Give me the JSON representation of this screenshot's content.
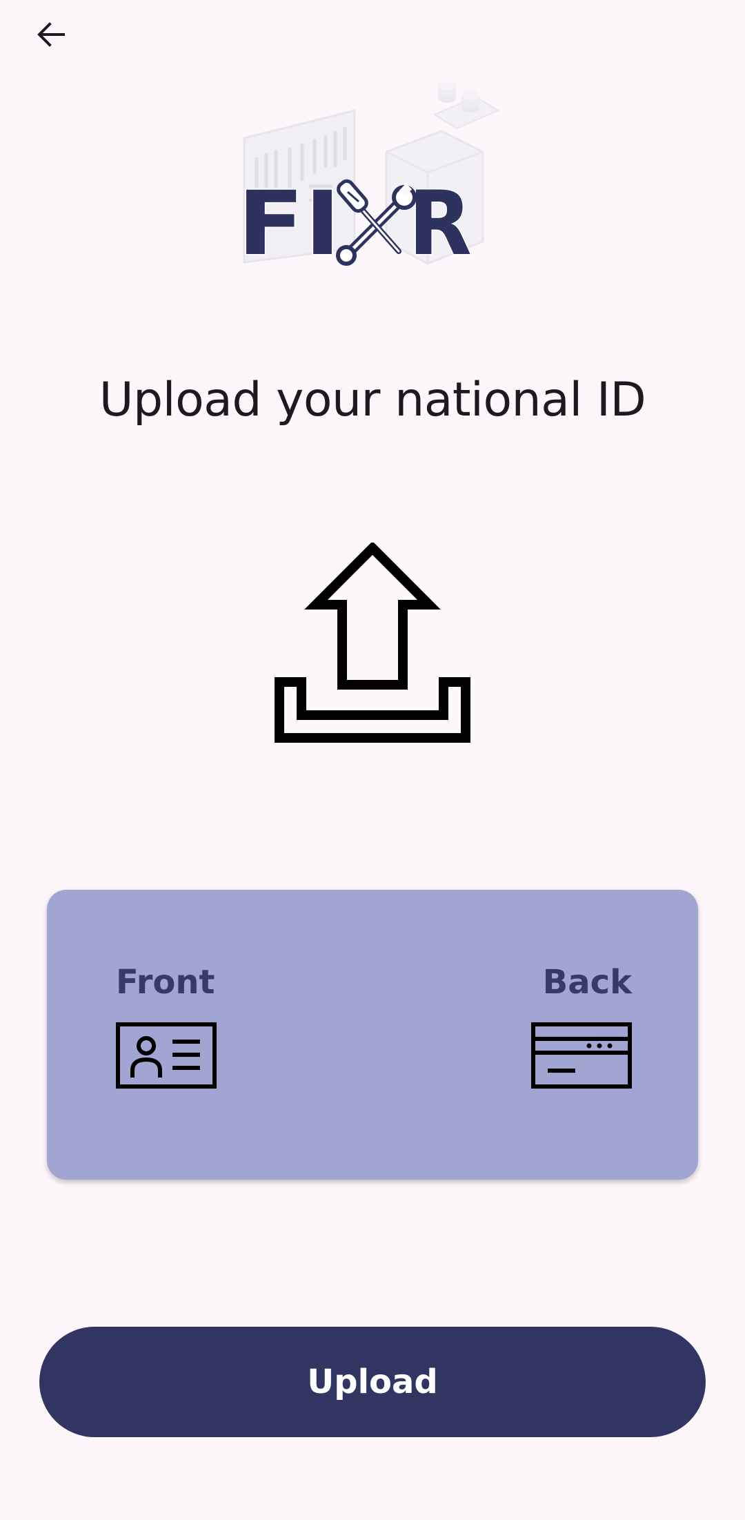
{
  "header": {
    "back_icon": "arrow-left-icon"
  },
  "logo": {
    "text": "FIXR",
    "left_letters": "FI",
    "right_letter": "R",
    "tools_icon": "screwdriver-wrench-icon",
    "color": "#2e325f"
  },
  "main": {
    "title": "Upload your national ID",
    "upload_icon": "upload-tray-icon"
  },
  "id_card": {
    "background": "#a0a5d1",
    "front": {
      "label": "Front",
      "icon": "id-card-front-icon"
    },
    "back": {
      "label": "Back",
      "icon": "id-card-back-icon"
    }
  },
  "actions": {
    "upload_label": "Upload",
    "button_color": "#313562"
  }
}
